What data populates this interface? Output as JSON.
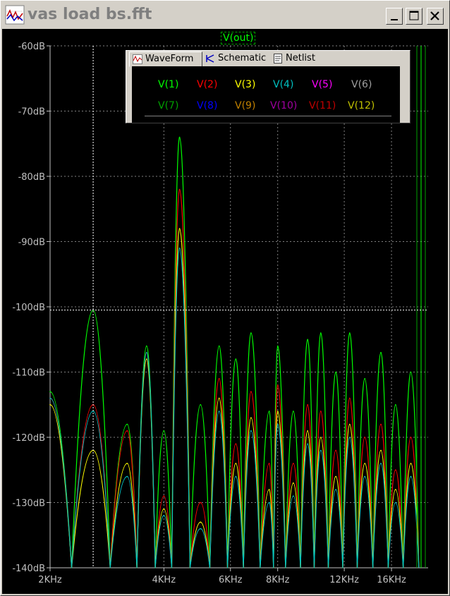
{
  "window": {
    "title": "vas load bs.fft"
  },
  "plot": {
    "trace_label": "V(out)"
  },
  "tabs": [
    {
      "label": "WaveForm",
      "icon": "waveform-icon",
      "active": true
    },
    {
      "label": "Schematic",
      "icon": "schematic-icon",
      "active": false
    },
    {
      "label": "Netlist",
      "icon": "netlist-icon",
      "active": false
    }
  ],
  "legend": [
    {
      "label": "V(1)",
      "color": "#00ff00"
    },
    {
      "label": "V(2)",
      "color": "#ff0000"
    },
    {
      "label": "V(3)",
      "color": "#ffff00"
    },
    {
      "label": "V(4)",
      "color": "#00c0c0"
    },
    {
      "label": "V(5)",
      "color": "#ff00ff"
    },
    {
      "label": "V(6)",
      "color": "#a0a0a0"
    },
    {
      "label": "V(7)",
      "color": "#00a000"
    },
    {
      "label": "V(8)",
      "color": "#0000ff"
    },
    {
      "label": "V(9)",
      "color": "#c08000"
    },
    {
      "label": "V(10)",
      "color": "#a000a0"
    },
    {
      "label": "V(11)",
      "color": "#c00000"
    },
    {
      "label": "V(12)",
      "color": "#c0c000"
    }
  ],
  "chart_data": {
    "type": "line",
    "title": "V(out)",
    "xlabel": "",
    "ylabel": "",
    "x_scale": "log",
    "xlim": [
      2000,
      20000
    ],
    "ylim": [
      -140,
      -60
    ],
    "y_ticks": [
      "-60dB",
      "-70dB",
      "-80dB",
      "-90dB",
      "-100dB",
      "-110dB",
      "-120dB",
      "-130dB",
      "-140dB"
    ],
    "x_ticks": [
      {
        "label": "2KHz",
        "value": 2000
      },
      {
        "label": "4KHz",
        "value": 4000
      },
      {
        "label": "6KHz",
        "value": 6000
      },
      {
        "label": "8KHz",
        "value": 8000
      },
      {
        "label": "12KHz",
        "value": 12000
      },
      {
        "label": "16KHz",
        "value": 16000
      }
    ],
    "cursor": {
      "x": 2600,
      "y": -100.5
    },
    "grid": true,
    "series": [
      {
        "name": "V(1)",
        "color": "#00ff00",
        "peaks": [
          {
            "f": 2000,
            "db": -113
          },
          {
            "f": 2600,
            "db": -100.5
          },
          {
            "f": 3200,
            "db": -118
          },
          {
            "f": 3600,
            "db": -106
          },
          {
            "f": 4000,
            "db": -119
          },
          {
            "f": 4400,
            "db": -74
          },
          {
            "f": 5000,
            "db": -115
          },
          {
            "f": 5600,
            "db": -106
          },
          {
            "f": 6200,
            "db": -108
          },
          {
            "f": 6800,
            "db": -104
          },
          {
            "f": 7600,
            "db": -116
          },
          {
            "f": 8000,
            "db": -106
          },
          {
            "f": 8800,
            "db": -116
          },
          {
            "f": 9600,
            "db": -105
          },
          {
            "f": 10400,
            "db": -104
          },
          {
            "f": 11400,
            "db": -110
          },
          {
            "f": 12400,
            "db": -104
          },
          {
            "f": 13600,
            "db": -111
          },
          {
            "f": 15000,
            "db": -107
          },
          {
            "f": 16400,
            "db": -115
          },
          {
            "f": 18000,
            "db": -110
          }
        ]
      },
      {
        "name": "V(2)",
        "color": "#ff0000",
        "peaks": [
          {
            "f": 2000,
            "db": -114
          },
          {
            "f": 2600,
            "db": -115
          },
          {
            "f": 3200,
            "db": -119
          },
          {
            "f": 3600,
            "db": -107
          },
          {
            "f": 4000,
            "db": -129
          },
          {
            "f": 4400,
            "db": -82
          },
          {
            "f": 5000,
            "db": -130
          },
          {
            "f": 5600,
            "db": -111
          },
          {
            "f": 6200,
            "db": -121
          },
          {
            "f": 6800,
            "db": -113
          },
          {
            "f": 7600,
            "db": -124
          },
          {
            "f": 8000,
            "db": -112
          },
          {
            "f": 8800,
            "db": -124
          },
          {
            "f": 9600,
            "db": -115
          },
          {
            "f": 10400,
            "db": -116
          },
          {
            "f": 11400,
            "db": -122
          },
          {
            "f": 12400,
            "db": -114
          },
          {
            "f": 13600,
            "db": -120
          },
          {
            "f": 15000,
            "db": -118
          },
          {
            "f": 16400,
            "db": -125
          },
          {
            "f": 18000,
            "db": -120
          }
        ]
      },
      {
        "name": "V(3)",
        "color": "#ffff00",
        "peaks": [
          {
            "f": 2000,
            "db": -115
          },
          {
            "f": 2600,
            "db": -122
          },
          {
            "f": 3200,
            "db": -124
          },
          {
            "f": 3600,
            "db": -108
          },
          {
            "f": 4000,
            "db": -131
          },
          {
            "f": 4400,
            "db": -88
          },
          {
            "f": 5000,
            "db": -133
          },
          {
            "f": 5600,
            "db": -114
          },
          {
            "f": 6200,
            "db": -124
          },
          {
            "f": 6800,
            "db": -117
          },
          {
            "f": 7600,
            "db": -128
          },
          {
            "f": 8000,
            "db": -116
          },
          {
            "f": 8800,
            "db": -127
          },
          {
            "f": 9600,
            "db": -119
          },
          {
            "f": 10400,
            "db": -120
          },
          {
            "f": 11400,
            "db": -126
          },
          {
            "f": 12400,
            "db": -118
          },
          {
            "f": 13600,
            "db": -124
          },
          {
            "f": 15000,
            "db": -122
          },
          {
            "f": 16400,
            "db": -128
          },
          {
            "f": 18000,
            "db": -124
          }
        ]
      },
      {
        "name": "V(4)",
        "color": "#00c0c0",
        "peaks": [
          {
            "f": 2000,
            "db": -114
          },
          {
            "f": 2600,
            "db": -116
          },
          {
            "f": 3200,
            "db": -126
          },
          {
            "f": 3600,
            "db": -107
          },
          {
            "f": 4000,
            "db": -132
          },
          {
            "f": 4400,
            "db": -91
          },
          {
            "f": 5000,
            "db": -134
          },
          {
            "f": 5600,
            "db": -116
          },
          {
            "f": 6200,
            "db": -126
          },
          {
            "f": 6800,
            "db": -119
          },
          {
            "f": 7600,
            "db": -130
          },
          {
            "f": 8000,
            "db": -118
          },
          {
            "f": 8800,
            "db": -129
          },
          {
            "f": 9600,
            "db": -121
          },
          {
            "f": 10400,
            "db": -122
          },
          {
            "f": 11400,
            "db": -128
          },
          {
            "f": 12400,
            "db": -120
          },
          {
            "f": 13600,
            "db": -126
          },
          {
            "f": 15000,
            "db": -124
          },
          {
            "f": 16400,
            "db": -130
          },
          {
            "f": 18000,
            "db": -126
          }
        ]
      }
    ]
  }
}
